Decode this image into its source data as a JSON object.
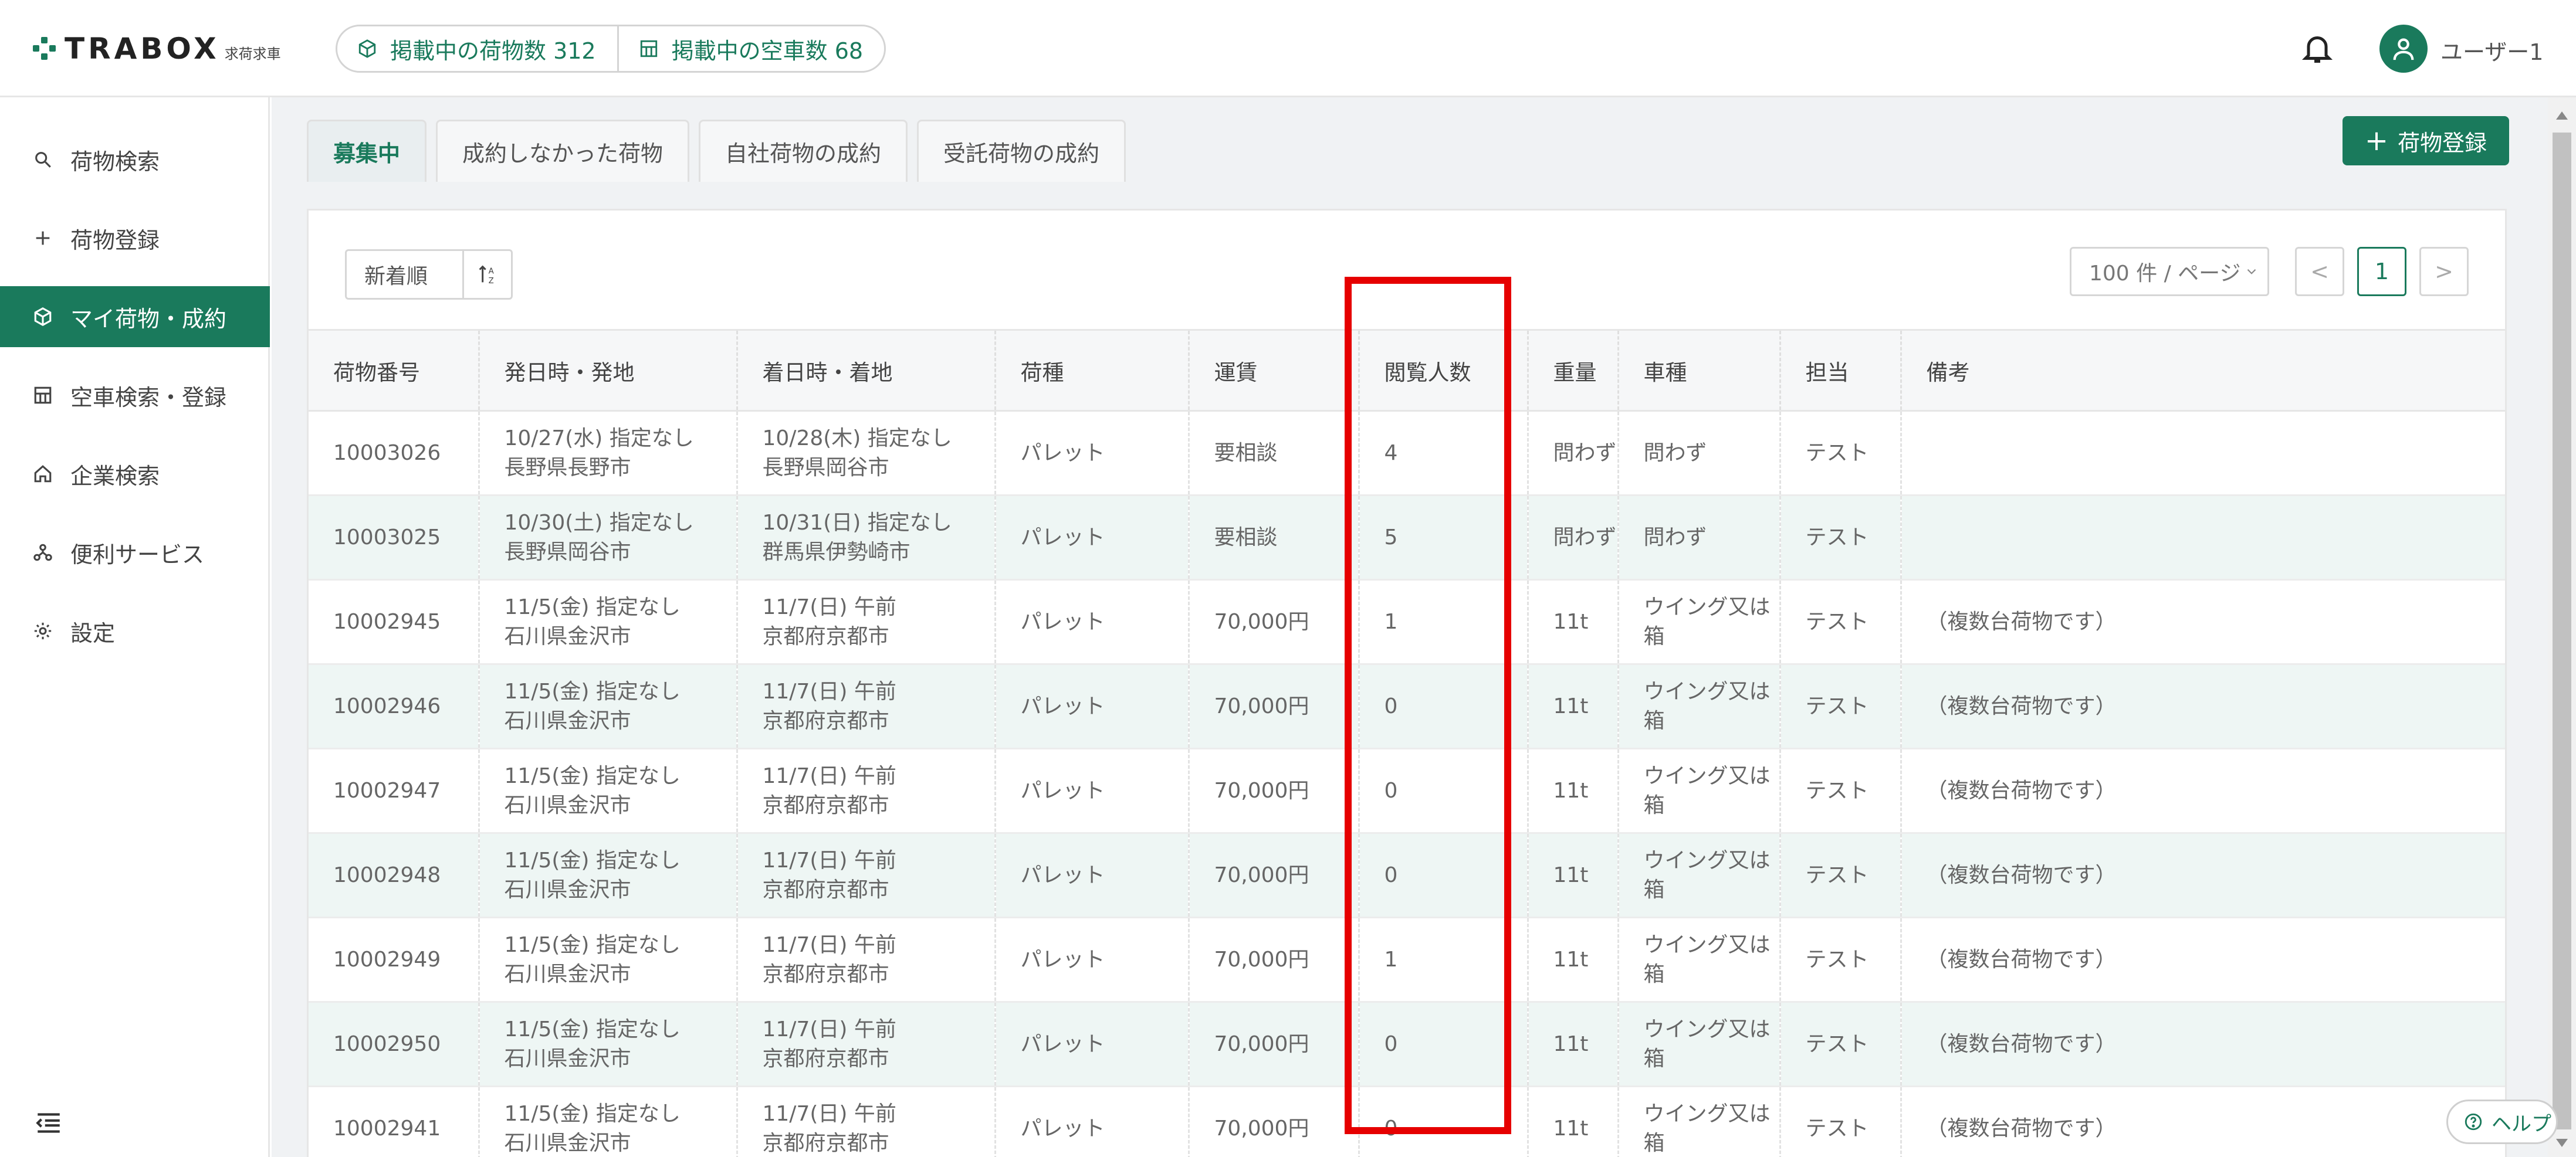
{
  "header": {
    "logo_text": "TRABOX",
    "logo_sub": "求荷求車",
    "cargo_count_label": "掲載中の荷物数 312",
    "vehicle_count_label": "掲載中の空車数 68",
    "user_name": "ユーザー1"
  },
  "sidebar": {
    "items": [
      {
        "label": "荷物検索",
        "icon": "search-icon"
      },
      {
        "label": "荷物登録",
        "icon": "plus-icon"
      },
      {
        "label": "マイ荷物・成約",
        "icon": "box-icon",
        "active": true
      },
      {
        "label": "空車検索・登録",
        "icon": "truck-icon"
      },
      {
        "label": "企業検索",
        "icon": "home-icon"
      },
      {
        "label": "便利サービス",
        "icon": "network-icon"
      },
      {
        "label": "設定",
        "icon": "gear-icon"
      }
    ]
  },
  "tabs": [
    {
      "label": "募集中",
      "active": true
    },
    {
      "label": "成約しなかった荷物"
    },
    {
      "label": "自社荷物の成約"
    },
    {
      "label": "受託荷物の成約"
    }
  ],
  "register_button": "荷物登録",
  "sort": {
    "label": "新着順"
  },
  "pagination": {
    "page_size": "100 件 / ページ",
    "current_page": "1",
    "prev": "<",
    "next": ">"
  },
  "table": {
    "columns": [
      "荷物番号",
      "発日時・発地",
      "着日時・着地",
      "荷種",
      "運賃",
      "閲覧人数",
      "重量",
      "車種",
      "担当",
      "備考"
    ],
    "rows": [
      {
        "id": "10003026",
        "dep_time": "10/27(水) 指定なし",
        "dep_place": "長野県長野市",
        "arr_time": "10/28(木) 指定なし",
        "arr_place": "長野県岡谷市",
        "type": "パレット",
        "fare": "要相談",
        "views": "4",
        "weight": "問わず",
        "vehicle": "問わず",
        "person": "テスト",
        "note": ""
      },
      {
        "id": "10003025",
        "dep_time": "10/30(土) 指定なし",
        "dep_place": "長野県岡谷市",
        "arr_time": "10/31(日) 指定なし",
        "arr_place": "群馬県伊勢崎市",
        "type": "パレット",
        "fare": "要相談",
        "views": "5",
        "weight": "問わず",
        "vehicle": "問わず",
        "person": "テスト",
        "note": ""
      },
      {
        "id": "10002945",
        "dep_time": "11/5(金) 指定なし",
        "dep_place": "石川県金沢市",
        "arr_time": "11/7(日) 午前",
        "arr_place": "京都府京都市",
        "type": "パレット",
        "fare": "70,000円",
        "views": "1",
        "weight": "11t",
        "vehicle": "ウイング又は箱",
        "person": "テスト",
        "note": "（複数台荷物です）"
      },
      {
        "id": "10002946",
        "dep_time": "11/5(金) 指定なし",
        "dep_place": "石川県金沢市",
        "arr_time": "11/7(日) 午前",
        "arr_place": "京都府京都市",
        "type": "パレット",
        "fare": "70,000円",
        "views": "0",
        "weight": "11t",
        "vehicle": "ウイング又は箱",
        "person": "テスト",
        "note": "（複数台荷物です）"
      },
      {
        "id": "10002947",
        "dep_time": "11/5(金) 指定なし",
        "dep_place": "石川県金沢市",
        "arr_time": "11/7(日) 午前",
        "arr_place": "京都府京都市",
        "type": "パレット",
        "fare": "70,000円",
        "views": "0",
        "weight": "11t",
        "vehicle": "ウイング又は箱",
        "person": "テスト",
        "note": "（複数台荷物です）"
      },
      {
        "id": "10002948",
        "dep_time": "11/5(金) 指定なし",
        "dep_place": "石川県金沢市",
        "arr_time": "11/7(日) 午前",
        "arr_place": "京都府京都市",
        "type": "パレット",
        "fare": "70,000円",
        "views": "0",
        "weight": "11t",
        "vehicle": "ウイング又は箱",
        "person": "テスト",
        "note": "（複数台荷物です）"
      },
      {
        "id": "10002949",
        "dep_time": "11/5(金) 指定なし",
        "dep_place": "石川県金沢市",
        "arr_time": "11/7(日) 午前",
        "arr_place": "京都府京都市",
        "type": "パレット",
        "fare": "70,000円",
        "views": "1",
        "weight": "11t",
        "vehicle": "ウイング又は箱",
        "person": "テスト",
        "note": "（複数台荷物です）"
      },
      {
        "id": "10002950",
        "dep_time": "11/5(金) 指定なし",
        "dep_place": "石川県金沢市",
        "arr_time": "11/7(日) 午前",
        "arr_place": "京都府京都市",
        "type": "パレット",
        "fare": "70,000円",
        "views": "0",
        "weight": "11t",
        "vehicle": "ウイング又は箱",
        "person": "テスト",
        "note": "（複数台荷物です）"
      },
      {
        "id": "10002941",
        "dep_time": "11/5(金) 指定なし",
        "dep_place": "石川県金沢市",
        "arr_time": "11/7(日) 午前",
        "arr_place": "京都府京都市",
        "type": "パレット",
        "fare": "70,000円",
        "views": "0",
        "weight": "11t",
        "vehicle": "ウイング又は箱",
        "person": "テスト",
        "note": "（複数台荷物です）"
      }
    ]
  },
  "help_label": "ヘルプ",
  "colors": {
    "brand": "#1a7a5c",
    "highlight": "#e60000",
    "row_alt": "#eef6f4"
  }
}
